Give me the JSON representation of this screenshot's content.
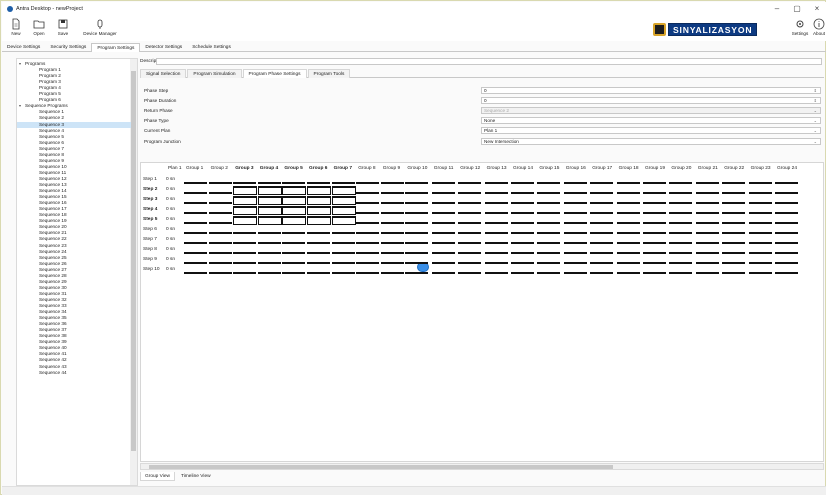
{
  "window": {
    "title": "Antra Desktop - newProject",
    "controls": [
      "–",
      "▢",
      "×"
    ]
  },
  "toolbar": {
    "new_label": "New",
    "open_label": "Open",
    "save_label": "Save",
    "device_manager_label": "Device Manager",
    "brand_text": "SINYALIZASYON",
    "settings_label": "Settings",
    "about_label": "About"
  },
  "top_tabs": [
    "Device Settings",
    "Security Settings",
    "Program Settings",
    "Detector Settings",
    "Schedule Settings"
  ],
  "tree": {
    "programs_label": "Programs",
    "programs": [
      "Program 1",
      "Program 2",
      "Program 3",
      "Program 4",
      "Program 5",
      "Program 6"
    ],
    "sequence_programs_label": "Sequence Programs",
    "sequences": [
      "Sequence 1",
      "Sequence 2",
      "Sequence 3",
      "Sequence 4",
      "Sequence 5",
      "Sequence 6",
      "Sequence 7",
      "Sequence 8",
      "Sequence 9",
      "Sequence 10",
      "Sequence 11",
      "Sequence 12",
      "Sequence 13",
      "Sequence 14",
      "Sequence 15",
      "Sequence 16",
      "Sequence 17",
      "Sequence 18",
      "Sequence 19",
      "Sequence 20",
      "Sequence 21",
      "Sequence 22",
      "Sequence 23",
      "Sequence 24",
      "Sequence 25",
      "Sequence 26",
      "Sequence 27",
      "Sequence 28",
      "Sequence 29",
      "Sequence 30",
      "Sequence 31",
      "Sequence 32",
      "Sequence 33",
      "Sequence 34",
      "Sequence 35",
      "Sequence 36",
      "Sequence 37",
      "Sequence 38",
      "Sequence 39",
      "Sequence 40",
      "Sequence 41",
      "Sequence 42",
      "Sequence 43",
      "Sequence 44"
    ],
    "selected": "Sequence 3"
  },
  "description_label": "Description",
  "sub_tabs": [
    "Signal Selection",
    "Program Simulation",
    "Program Phase Settings",
    "Program Tools"
  ],
  "fields": [
    {
      "label": "Phase Step",
      "value": "0",
      "kind": "spin"
    },
    {
      "label": "Phase Duration",
      "value": "0",
      "kind": "spin"
    },
    {
      "label": "Return Phase",
      "value": "Sequence 2",
      "kind": "disabled"
    },
    {
      "label": "Phase Type",
      "value": "None",
      "kind": "select"
    },
    {
      "label": "Current Plan",
      "value": "Plan 1",
      "kind": "select"
    },
    {
      "label": "Program Junction",
      "value": "New Intersection",
      "kind": "select"
    }
  ],
  "grid": {
    "plan_header": "Plan 1",
    "groups": [
      "Group 1",
      "Group 2",
      "Group 3",
      "Group 4",
      "Group 5",
      "Group 6",
      "Group 7",
      "Group 8",
      "Group 9",
      "Group 10",
      "Group 11",
      "Group 12",
      "Group 13",
      "Group 14",
      "Group 15",
      "Group 16",
      "Group 17",
      "Group 18",
      "Group 19",
      "Group 20",
      "Group 21",
      "Group 22",
      "Group 23",
      "Group 24"
    ],
    "bold_groups": [
      "Group 3",
      "Group 4",
      "Group 5",
      "Group 6",
      "Group 7"
    ],
    "steps": [
      {
        "label": "Step 1",
        "value": "0 sn",
        "bold": false
      },
      {
        "label": "Step 2",
        "value": "0 sn",
        "bold": true
      },
      {
        "label": "Step 3",
        "value": "0 sn",
        "bold": true
      },
      {
        "label": "Step 4",
        "value": "0 sn",
        "bold": true
      },
      {
        "label": "Step 5",
        "value": "0 sn",
        "bold": true
      },
      {
        "label": "Step 6",
        "value": "0 sn",
        "bold": false
      },
      {
        "label": "Step 7",
        "value": "0 sn",
        "bold": false
      },
      {
        "label": "Step 8",
        "value": "0 sn",
        "bold": false
      },
      {
        "label": "Step 9",
        "value": "0 sn",
        "bold": false
      },
      {
        "label": "Step 10",
        "value": "0 sn",
        "bold": false
      }
    ]
  },
  "bottom_tabs": [
    "Group View",
    "Timeline View"
  ],
  "colors": {
    "brand_blue": "#0d3a82",
    "selection": "#cde4f7",
    "cursor": "#3a8ee6"
  }
}
